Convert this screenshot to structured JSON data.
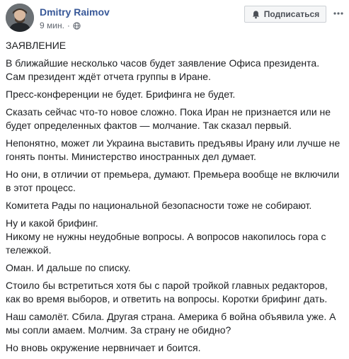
{
  "post": {
    "author": "Dmitry Raimov",
    "time": "9 мин.",
    "dot": "·",
    "subscribe_label": "Подписаться",
    "paragraphs": [
      [
        "ЗАЯВЛЕНИЕ"
      ],
      [
        "В ближайшие несколько часов будет заявление Офиса президента.",
        "Сам президент ждёт отчета группы в Иране."
      ],
      [
        "Пресс-конференции не будет. Брифинга не будет."
      ],
      [
        "Сказать сейчас что-то новое сложно. Пока Иран не признается или не",
        "будет определенных фактов — молчание. Так сказал первый."
      ],
      [
        "Непонятно, может ли Украина выставить предъявы Ирану или лучше не",
        "гонять понты. Министерство иностранных дел думает."
      ],
      [
        "Но они, в отличии от премьера, думают. Премьера вообще не включили",
        "в этот процесс."
      ],
      [
        "Комитета Рады по национальной безопасности тоже не собирают."
      ],
      [
        "Ну и какой брифинг.",
        "Никому не нужны неудобные вопросы. А вопросов накопилось гора с",
        "тележкой."
      ],
      [
        "Оман. И дальше по списку."
      ],
      [
        "Стоило бы встретиться хотя бы с парой тройкой главных редакторов,",
        "как во время выборов, и ответить на вопросы. Коротки брифинг дать."
      ],
      [
        "Наш самолёт. Сбила. Другая страна. Америка б война объявила уже. А",
        "мы сопли амаем. Молчим. За страну не обидно?"
      ],
      [
        "Но вновь окружение нервничает и боится."
      ]
    ]
  },
  "icons": {
    "globe": "globe-icon",
    "bell": "bell-icon",
    "more": "more-dots-icon"
  },
  "colors": {
    "author": "#385898",
    "text": "#1c1e21",
    "meta": "#616770",
    "button_bg": "#f5f6f7"
  }
}
